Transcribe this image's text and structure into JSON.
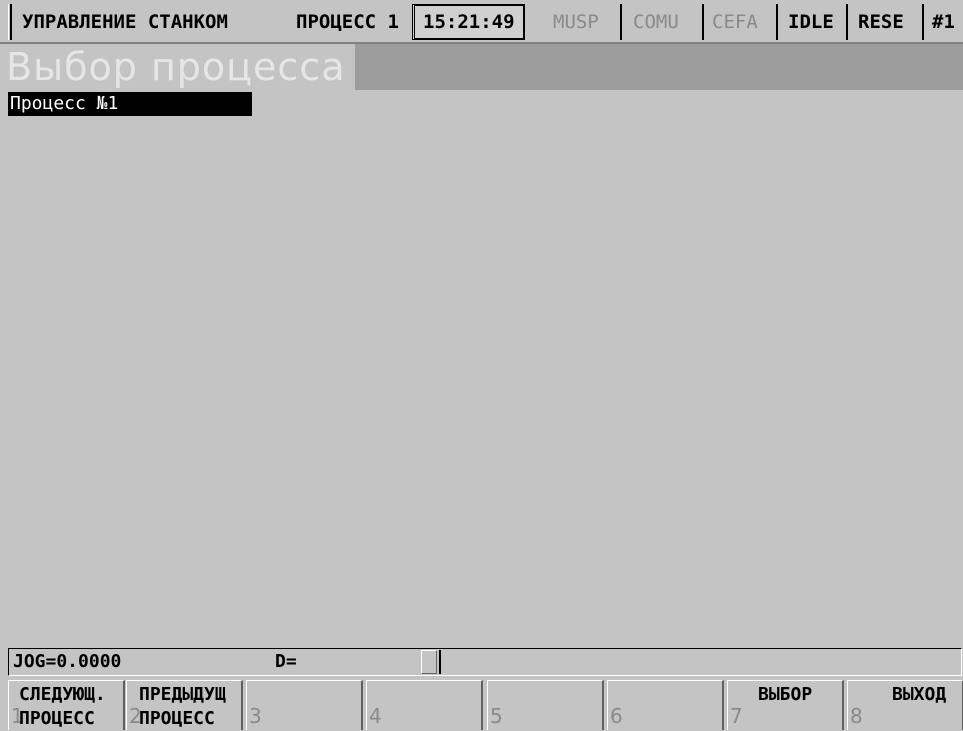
{
  "header": {
    "app_title": "УПРАВЛЕНИЕ СТАНКОМ",
    "process": "ПРОЦЕСС 1",
    "time": "15:21:49",
    "indicators": [
      "MUSP",
      "COMU",
      "CEFA"
    ],
    "mode": "IDLE",
    "reset": "RESE",
    "channel": "#1"
  },
  "screen": {
    "title": "Выбор процесса",
    "items": [
      "Процесс №1"
    ]
  },
  "status": {
    "jog": "JOG=0.0000",
    "d": "D="
  },
  "softkeys": [
    {
      "num": "1",
      "label": "СЛЕДУЮЩ.\nПРОЦЕСС"
    },
    {
      "num": "2",
      "label": "ПРЕДЫДУЩ\nПРОЦЕСС"
    },
    {
      "num": "3",
      "label": ""
    },
    {
      "num": "4",
      "label": ""
    },
    {
      "num": "5",
      "label": ""
    },
    {
      "num": "6",
      "label": ""
    },
    {
      "num": "7",
      "label": "ВЫБОР"
    },
    {
      "num": "8",
      "label": "ВЫХОД"
    }
  ]
}
